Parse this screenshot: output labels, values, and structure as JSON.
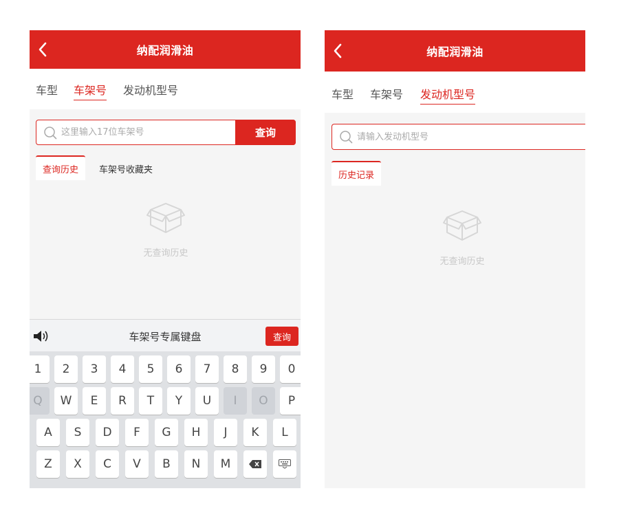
{
  "left_screen": {
    "header": {
      "title": "纳配润滑油"
    },
    "tabs": [
      {
        "label": "车型"
      },
      {
        "label": "车架号"
      },
      {
        "label": "发动机型号"
      }
    ],
    "search": {
      "placeholder": "这里输入17位车架号",
      "button_label": "查询"
    },
    "sub_tabs": [
      {
        "label": "查询历史"
      },
      {
        "label": "车架号收藏夹"
      }
    ],
    "empty_text": "无查询历史",
    "keyboard": {
      "title": "车架号专属键盘",
      "query_label": "查询",
      "rows": [
        [
          "1",
          "2",
          "3",
          "4",
          "5",
          "6",
          "7",
          "8",
          "9",
          "0"
        ],
        [
          "Q",
          "W",
          "E",
          "R",
          "T",
          "Y",
          "U",
          "I",
          "O",
          "P"
        ],
        [
          "A",
          "S",
          "D",
          "F",
          "G",
          "H",
          "J",
          "K",
          "L"
        ],
        [
          "Z",
          "X",
          "C",
          "V",
          "B",
          "N",
          "M"
        ]
      ],
      "disabled_keys": [
        "Q",
        "I",
        "O"
      ]
    }
  },
  "right_screen": {
    "header": {
      "title": "纳配润滑油"
    },
    "tabs": [
      {
        "label": "车型"
      },
      {
        "label": "车架号"
      },
      {
        "label": "发动机型号"
      }
    ],
    "search": {
      "placeholder": "请输入发动机型号"
    },
    "sub_tabs": [
      {
        "label": "历史记录"
      }
    ],
    "empty_text": "无查询历史"
  },
  "colors": {
    "accent": "#dc2620",
    "background": "#f5f5f5",
    "muted_text": "#c8c8c8"
  },
  "icons": [
    "back-arrow-icon",
    "search-icon",
    "empty-box-icon",
    "speaker-icon",
    "backspace-icon",
    "keyboard-hide-icon"
  ]
}
